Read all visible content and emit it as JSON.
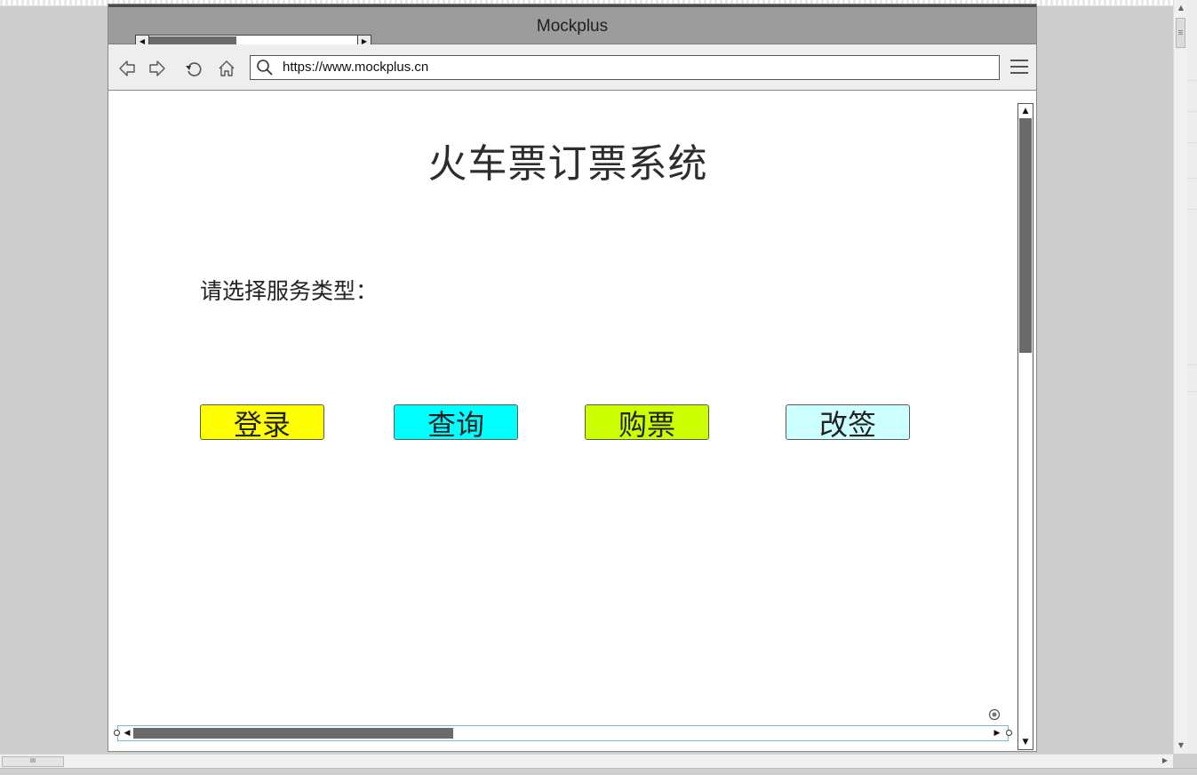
{
  "window": {
    "title": "Mockplus"
  },
  "browser": {
    "url": "https://www.mockplus.cn"
  },
  "page": {
    "title": "火车票订票系统",
    "prompt": "请选择服务类型：",
    "buttons": [
      {
        "label": "登录",
        "color": "#ffff00"
      },
      {
        "label": "查询",
        "color": "#00ffff"
      },
      {
        "label": "购票",
        "color": "#ccff00"
      },
      {
        "label": "改签",
        "color": "#ccffff"
      }
    ]
  },
  "editor": {
    "hscroll_label": "III"
  },
  "icons": [
    "back-icon",
    "forward-icon",
    "refresh-icon",
    "home-icon",
    "search-icon",
    "hamburger-menu-icon",
    "anchor-icon"
  ]
}
